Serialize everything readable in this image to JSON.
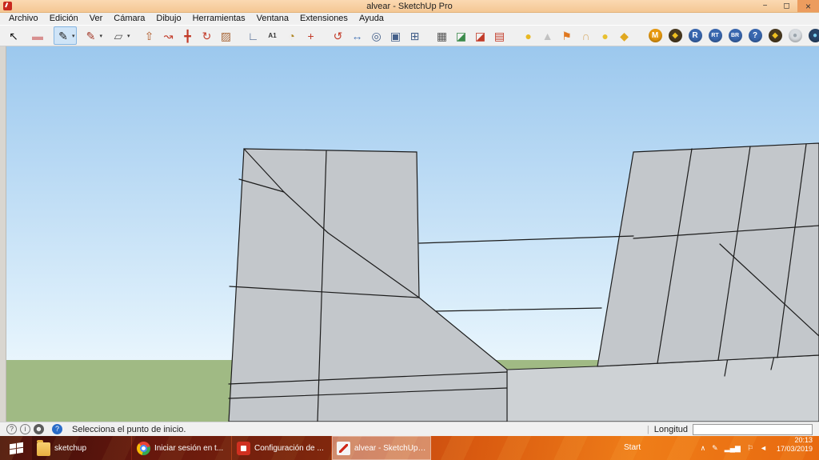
{
  "window": {
    "title": "alvear - SketchUp Pro",
    "controls": {
      "minimize": "−",
      "restore": "◻",
      "close": "×"
    }
  },
  "menu": {
    "items": [
      "Archivo",
      "Edición",
      "Ver",
      "Cámara",
      "Dibujo",
      "Herramientas",
      "Ventana",
      "Extensiones",
      "Ayuda"
    ]
  },
  "toolbar": {
    "caret": "▾",
    "tools": [
      {
        "name": "select-tool",
        "glyph": "↖",
        "color": "#111111"
      },
      {
        "name": "eraser-tool",
        "glyph": "▬",
        "color": "#d89090",
        "gap": 6
      },
      {
        "name": "line-tool",
        "glyph": "✎",
        "color": "#222222",
        "caret": true,
        "selected": true,
        "gap": 8
      },
      {
        "name": "freehand-tool",
        "glyph": "✎",
        "color": "#a33a2a",
        "caret": true,
        "gap": 6
      },
      {
        "name": "rectangle-tool",
        "glyph": "▱",
        "color": "#555555",
        "caret": true,
        "gap": 6
      },
      {
        "name": "pushpull-tool",
        "glyph": "⇧",
        "color": "#b05a28",
        "gap": 10
      },
      {
        "name": "followme-tool",
        "glyph": "↝",
        "color": "#c23a28"
      },
      {
        "name": "move-tool",
        "glyph": "╋",
        "color": "#c23a28"
      },
      {
        "name": "rotate-tool",
        "glyph": "↻",
        "color": "#c23a28"
      },
      {
        "name": "scale-tool",
        "glyph": "▨",
        "color": "#a8683a"
      },
      {
        "name": "tape-measure-tool",
        "glyph": "∟",
        "color": "#44608a",
        "gap": 10
      },
      {
        "name": "dimension-tool",
        "glyph": "A1",
        "color": "#333333"
      },
      {
        "name": "protractor-tool",
        "glyph": "◔",
        "color": "#b08828"
      },
      {
        "name": "axes-tool",
        "glyph": "+",
        "color": "#c23a28"
      },
      {
        "name": "orbit-tool",
        "glyph": "↺",
        "color": "#c23a28",
        "gap": 10
      },
      {
        "name": "pan-tool",
        "glyph": "↔",
        "color": "#4a78b8"
      },
      {
        "name": "zoom-tool",
        "glyph": "◎",
        "color": "#44608a"
      },
      {
        "name": "zoom-window-tool",
        "glyph": "▣",
        "color": "#44608a"
      },
      {
        "name": "zoom-extents-tool",
        "glyph": "⊞",
        "color": "#44608a"
      },
      {
        "name": "styles-tool",
        "glyph": "▦",
        "color": "#555555",
        "gap": 10
      },
      {
        "name": "section-plane-tool",
        "glyph": "◪",
        "color": "#3a8a4a"
      },
      {
        "name": "section-display-toggle",
        "glyph": "◪",
        "color": "#c23a28"
      },
      {
        "name": "section-cut-toggle",
        "glyph": "▤",
        "color": "#c23a28"
      },
      {
        "name": "plugin-sphere-button",
        "glyph": "●",
        "color": "#e8b822",
        "gap": 12
      },
      {
        "name": "plugin-cone-button",
        "glyph": "▲",
        "color": "#c2c2c2"
      },
      {
        "name": "plugin-flag-button",
        "glyph": "⚑",
        "color": "#e07820"
      },
      {
        "name": "plugin-dome-button",
        "glyph": "∩",
        "color": "#d8b070"
      },
      {
        "name": "plugin-coin-button",
        "glyph": "●",
        "color": "#e8c030"
      },
      {
        "name": "plugin-pick-button",
        "glyph": "◆",
        "color": "#e0a820"
      },
      {
        "name": "plugin-m-button",
        "glyph": "M",
        "circle": "#e89a10",
        "color": "#ffffff",
        "gap": 14
      },
      {
        "name": "plugin-diamond-button-1",
        "glyph": "◆",
        "circle": "#4a3a20",
        "color": "#f0c020"
      },
      {
        "name": "plugin-r-button",
        "glyph": "R",
        "circle": "#3a68b0",
        "color": "#ffffff"
      },
      {
        "name": "plugin-rt-button",
        "glyph": "RT",
        "circle": "#3a68b0",
        "color": "#ffffff"
      },
      {
        "name": "plugin-br-button",
        "glyph": "BR",
        "circle": "#3a68b0",
        "color": "#ffffff"
      },
      {
        "name": "plugin-help-button",
        "glyph": "?",
        "circle": "#3a68b0",
        "color": "#ffffff"
      },
      {
        "name": "plugin-diamond-button-2",
        "glyph": "◆",
        "circle": "#4a3a20",
        "color": "#f0c020"
      },
      {
        "name": "plugin-globe-button",
        "glyph": "●",
        "circle": "#d8dce0",
        "color": "#9aa4ac"
      },
      {
        "name": "plugin-world-button",
        "glyph": "●",
        "circle": "#284468",
        "color": "#77ccee"
      }
    ]
  },
  "viewport": {
    "colors": {
      "sky_top": "#9cc8ee",
      "sky_low": "#ddeffb",
      "grass": "#a0ba84",
      "face": "#c3c7cb",
      "slab": "#ced2d5",
      "edge": "#1c1c1c"
    }
  },
  "ui_colors": {
    "titlebar_bg": "#f4c794",
    "titlebar_hi": "#fbd9b2",
    "selection": "#cfe4f7"
  },
  "statusbar": {
    "icons": [
      {
        "name": "help-circle-icon",
        "glyph": "?",
        "style": "outline"
      },
      {
        "name": "info-circle-icon",
        "glyph": "i",
        "style": "outline"
      },
      {
        "name": "user-circle-icon",
        "glyph": "☻",
        "style": "dark"
      },
      {
        "name": "question-badge-icon",
        "glyph": "?",
        "style": "blue"
      }
    ],
    "message": "Selecciona el punto de inicio.",
    "measure_label": "Longitud",
    "measure_value": ""
  },
  "taskbar": {
    "items": [
      {
        "name": "taskbar-item-sketchup-folder",
        "label": "sketchup",
        "icon": "folder",
        "active": false
      },
      {
        "name": "taskbar-item-chrome",
        "label": "Iniciar sesión en t...",
        "icon": "chrome",
        "active": false
      },
      {
        "name": "taskbar-item-config",
        "label": "Configuración de ...",
        "icon": "redapp",
        "active": false
      },
      {
        "name": "taskbar-item-sketchup-app",
        "label": "alvear - SketchUp ...",
        "icon": "sketchup",
        "active": true
      }
    ],
    "start_label": "Start",
    "tray": [
      {
        "name": "tray-chevron-up-icon",
        "glyph": "∧"
      },
      {
        "name": "tray-pen-icon",
        "glyph": "✎"
      },
      {
        "name": "tray-signal-icon",
        "glyph": "▂▄▆"
      },
      {
        "name": "tray-flag-icon",
        "glyph": "⚐"
      },
      {
        "name": "tray-volume-icon",
        "glyph": "◄"
      }
    ],
    "clock": {
      "time": "20:13",
      "date": "17/03/2019"
    }
  }
}
